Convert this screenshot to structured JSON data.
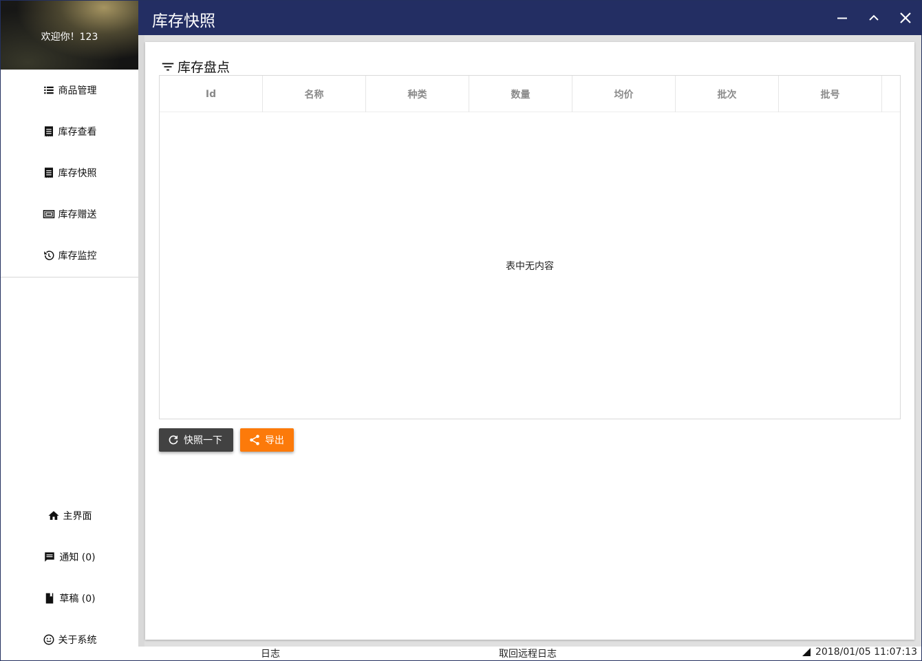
{
  "window": {
    "title": "库存快照",
    "titlebar_color": "#232e63"
  },
  "sidebar": {
    "welcome": "欢迎你！123",
    "nav_items": [
      {
        "label": "商品管理",
        "icon": "list-icon"
      },
      {
        "label": "库存查看",
        "icon": "receipt-icon"
      },
      {
        "label": "库存快照",
        "icon": "receipt-icon"
      },
      {
        "label": "库存赠送",
        "icon": "money-icon"
      },
      {
        "label": "库存监控",
        "icon": "history-icon"
      }
    ],
    "bottom_items": [
      {
        "label": "主界面",
        "icon": "home-icon"
      },
      {
        "label": "通知 (0)",
        "icon": "message-icon"
      },
      {
        "label": "草稿 (0)",
        "icon": "book-icon"
      },
      {
        "label": "关于系统",
        "icon": "smile-icon"
      }
    ]
  },
  "main": {
    "section_title": "库存盘点",
    "table": {
      "columns": [
        "Id",
        "名称",
        "种类",
        "数量",
        "均价",
        "批次",
        "批号"
      ],
      "rows": [],
      "empty_text": "表中无内容"
    },
    "buttons": {
      "snapshot": "快照一下",
      "export": "导出"
    },
    "accent_color": "#fc7a0a"
  },
  "statusbar": {
    "log": "日志",
    "fetch_remote_log": "取回远程日志",
    "datetime": "2018/01/05 11:07:13"
  }
}
